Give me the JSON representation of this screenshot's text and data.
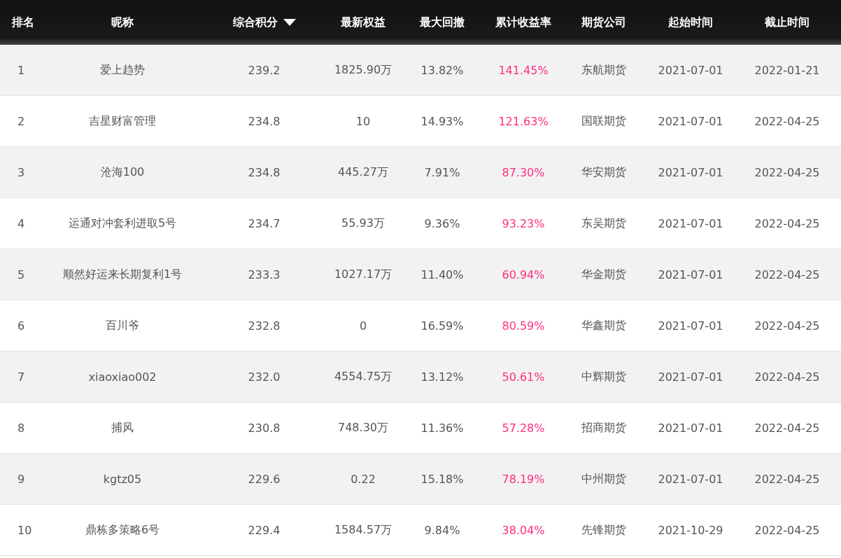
{
  "table": {
    "columns": [
      {
        "label": "排名",
        "kind": "text",
        "sorted": false
      },
      {
        "label": "昵称",
        "kind": "text",
        "sorted": false
      },
      {
        "label": "综合积分",
        "kind": "text",
        "sorted": true
      },
      {
        "label": "最新权益",
        "kind": "text",
        "sorted": false
      },
      {
        "label": "最大回撤",
        "kind": "text",
        "sorted": false
      },
      {
        "label": "累计收益率",
        "kind": "rate",
        "sorted": false
      },
      {
        "label": "期货公司",
        "kind": "text",
        "sorted": false
      },
      {
        "label": "起始时间",
        "kind": "text",
        "sorted": false
      },
      {
        "label": "截止时间",
        "kind": "text",
        "sorted": false
      }
    ],
    "rows": [
      [
        "1",
        "爱上趋势",
        "239.2",
        "1825.90万",
        "13.82%",
        "141.45%",
        "东航期货",
        "2021-07-01",
        "2022-01-21"
      ],
      [
        "2",
        "吉星财富管理",
        "234.8",
        "10",
        "14.93%",
        "121.63%",
        "国联期货",
        "2021-07-01",
        "2022-04-25"
      ],
      [
        "3",
        "沧海100",
        "234.8",
        "445.27万",
        "7.91%",
        "87.30%",
        "华安期货",
        "2021-07-01",
        "2022-04-25"
      ],
      [
        "4",
        "运通对冲套利进取5号",
        "234.7",
        "55.93万",
        "9.36%",
        "93.23%",
        "东吴期货",
        "2021-07-01",
        "2022-04-25"
      ],
      [
        "5",
        "顺然好运来长期复利1号",
        "233.3",
        "1027.17万",
        "11.40%",
        "60.94%",
        "华金期货",
        "2021-07-01",
        "2022-04-25"
      ],
      [
        "6",
        "百川爷",
        "232.8",
        "0",
        "16.59%",
        "80.59%",
        "华鑫期货",
        "2021-07-01",
        "2022-04-25"
      ],
      [
        "7",
        "xiaoxiao002",
        "232.0",
        "4554.75万",
        "13.12%",
        "50.61%",
        "中辉期货",
        "2021-07-01",
        "2022-04-25"
      ],
      [
        "8",
        "捕风",
        "230.8",
        "748.30万",
        "11.36%",
        "57.28%",
        "招商期货",
        "2021-07-01",
        "2022-04-25"
      ],
      [
        "9",
        "kgtz05",
        "229.6",
        "0.22",
        "15.18%",
        "78.19%",
        "中州期货",
        "2021-07-01",
        "2022-04-25"
      ],
      [
        "10",
        "鼎栋多策略6号",
        "229.4",
        "1584.57万",
        "9.84%",
        "38.04%",
        "先锋期货",
        "2021-10-29",
        "2022-04-25"
      ]
    ]
  }
}
